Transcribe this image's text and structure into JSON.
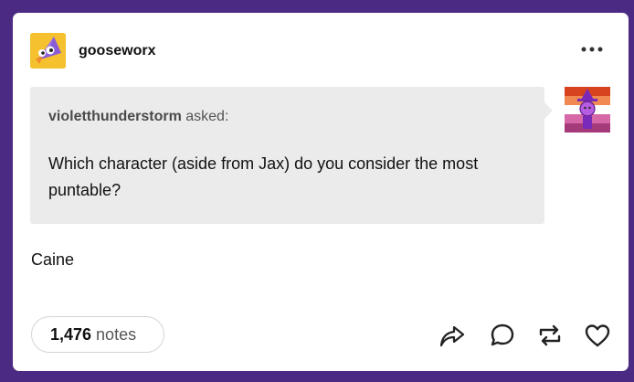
{
  "post": {
    "author": "gooseworx",
    "ask": {
      "asker": "violetthunderstorm",
      "asked_label": "asked:",
      "question": "Which character (aside from Jax) do you consider the most puntable?"
    },
    "answer": "Caine",
    "notes_count": "1,476",
    "notes_label": "notes"
  },
  "icons": {
    "menu": "more-options-icon",
    "share": "share-icon",
    "reply": "reply-icon",
    "reblog": "reblog-icon",
    "like": "heart-icon"
  },
  "colors": {
    "background": "#4b2a83",
    "card": "#ffffff",
    "ask_box": "#ebebeb"
  }
}
